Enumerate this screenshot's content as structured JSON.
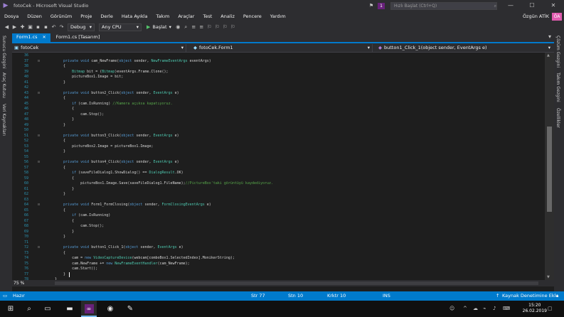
{
  "window": {
    "title": "fotoCek - Microsoft Visual Studio",
    "notifications_count": "1",
    "quick_launch_placeholder": "Hızlı Başlat (Ctrl+Q)",
    "minimize": "—",
    "maximize": "☐",
    "close": "✕"
  },
  "menu": {
    "items": [
      "Dosya",
      "Düzen",
      "Görünüm",
      "Proje",
      "Derle",
      "Hata Ayıkla",
      "Takım",
      "Araçlar",
      "Test",
      "Analiz",
      "Pencere",
      "Yardım"
    ],
    "user_name": "Özgün ATİK",
    "user_initials": "ÖA"
  },
  "toolbar": {
    "config": "Debug",
    "platform": "Any CPU",
    "run_label": "Başlat"
  },
  "left_dock": [
    "Sunucu Gezgini",
    "Araç Kutusu",
    "Veri Kaynakları"
  ],
  "right_dock": [
    "Çözüm Gezgini",
    "Takım Gezgini",
    "Özellikler"
  ],
  "tabs": [
    {
      "label": "Form1.cs",
      "close": "✕"
    },
    {
      "label": "Form1.cs [Tasarım]"
    }
  ],
  "navbar": {
    "project": "fotoCek",
    "class": "fotoCek.Form1",
    "member": "button1_Click_1(object sender, EventArgs e)"
  },
  "code_lines": [
    {
      "n": "36",
      "f": "",
      "t": [
        {
          "c": "",
          "s": ""
        }
      ]
    },
    {
      "n": "37",
      "f": "⊟",
      "t": [
        {
          "c": "kw",
          "s": "    private void "
        },
        {
          "c": "",
          "s": "cam_NewFrame("
        },
        {
          "c": "kw",
          "s": "object"
        },
        {
          "c": "",
          "s": " sender, "
        },
        {
          "c": "ty",
          "s": "NewFrameEventArgs"
        },
        {
          "c": "",
          "s": " eventArgs)"
        }
      ]
    },
    {
      "n": "38",
      "f": "",
      "t": [
        {
          "c": "",
          "s": "    {"
        }
      ]
    },
    {
      "n": "39",
      "f": "",
      "t": [
        {
          "c": "",
          "s": "        "
        },
        {
          "c": "ty",
          "s": "Bitmap"
        },
        {
          "c": "",
          "s": " bit = ("
        },
        {
          "c": "ty",
          "s": "Bitmap"
        },
        {
          "c": "",
          "s": ")eventArgs.Frame.Clone();"
        }
      ]
    },
    {
      "n": "40",
      "f": "",
      "t": [
        {
          "c": "",
          "s": "        pictureBox1.Image = bit;"
        }
      ]
    },
    {
      "n": "41",
      "f": "",
      "t": [
        {
          "c": "",
          "s": "    }"
        }
      ]
    },
    {
      "n": "42",
      "f": "",
      "t": [
        {
          "c": "",
          "s": ""
        }
      ]
    },
    {
      "n": "43",
      "f": "⊟",
      "t": [
        {
          "c": "kw",
          "s": "    private void "
        },
        {
          "c": "",
          "s": "button2_Click("
        },
        {
          "c": "kw",
          "s": "object"
        },
        {
          "c": "",
          "s": " sender, "
        },
        {
          "c": "ty",
          "s": "EventArgs"
        },
        {
          "c": "",
          "s": " e)"
        }
      ]
    },
    {
      "n": "44",
      "f": "",
      "t": [
        {
          "c": "",
          "s": "    {"
        }
      ]
    },
    {
      "n": "45",
      "f": "",
      "t": [
        {
          "c": "kw",
          "s": "        if"
        },
        {
          "c": "",
          "s": " (cam.IsRunning) "
        },
        {
          "c": "cm",
          "s": "//Kamera açıksa kapatıyoruz."
        }
      ]
    },
    {
      "n": "46",
      "f": "",
      "t": [
        {
          "c": "",
          "s": "        {"
        }
      ]
    },
    {
      "n": "47",
      "f": "",
      "t": [
        {
          "c": "",
          "s": "            cam.Stop();"
        }
      ]
    },
    {
      "n": "48",
      "f": "",
      "t": [
        {
          "c": "",
          "s": "        }"
        }
      ]
    },
    {
      "n": "49",
      "f": "",
      "t": [
        {
          "c": "",
          "s": "    }"
        }
      ]
    },
    {
      "n": "50",
      "f": "",
      "t": [
        {
          "c": "",
          "s": ""
        }
      ]
    },
    {
      "n": "51",
      "f": "⊟",
      "t": [
        {
          "c": "kw",
          "s": "    private void "
        },
        {
          "c": "",
          "s": "button3_Click("
        },
        {
          "c": "kw",
          "s": "object"
        },
        {
          "c": "",
          "s": " sender, "
        },
        {
          "c": "ty",
          "s": "EventArgs"
        },
        {
          "c": "",
          "s": " e)"
        }
      ]
    },
    {
      "n": "52",
      "f": "",
      "t": [
        {
          "c": "",
          "s": "    {"
        }
      ]
    },
    {
      "n": "53",
      "f": "",
      "t": [
        {
          "c": "",
          "s": "        pictureBox2.Image = pictureBox1.Image;"
        }
      ]
    },
    {
      "n": "54",
      "f": "",
      "t": [
        {
          "c": "",
          "s": "    }"
        }
      ]
    },
    {
      "n": "55",
      "f": "",
      "t": [
        {
          "c": "",
          "s": ""
        }
      ]
    },
    {
      "n": "56",
      "f": "⊟",
      "t": [
        {
          "c": "kw",
          "s": "    private void "
        },
        {
          "c": "",
          "s": "button4_Click("
        },
        {
          "c": "kw",
          "s": "object"
        },
        {
          "c": "",
          "s": " sender, "
        },
        {
          "c": "ty",
          "s": "EventArgs"
        },
        {
          "c": "",
          "s": " e)"
        }
      ]
    },
    {
      "n": "57",
      "f": "",
      "t": [
        {
          "c": "",
          "s": "    {"
        }
      ]
    },
    {
      "n": "58",
      "f": "",
      "t": [
        {
          "c": "kw",
          "s": "        if"
        },
        {
          "c": "",
          "s": " (saveFileDialog1.ShowDialog() == "
        },
        {
          "c": "ty",
          "s": "DialogResult"
        },
        {
          "c": "",
          "s": ".OK)"
        }
      ]
    },
    {
      "n": "59",
      "f": "",
      "t": [
        {
          "c": "",
          "s": "        {"
        }
      ]
    },
    {
      "n": "60",
      "f": "",
      "t": [
        {
          "c": "",
          "s": "            pictureBox1.Image.Save(saveFileDialog1.FileName);"
        },
        {
          "c": "cm",
          "s": "//PictureBox'taki görüntüyü kaydediyoruz."
        }
      ]
    },
    {
      "n": "61",
      "f": "",
      "t": [
        {
          "c": "",
          "s": "        }"
        }
      ]
    },
    {
      "n": "62",
      "f": "",
      "t": [
        {
          "c": "",
          "s": "    }"
        }
      ]
    },
    {
      "n": "63",
      "f": "",
      "t": [
        {
          "c": "",
          "s": ""
        }
      ]
    },
    {
      "n": "64",
      "f": "⊟",
      "t": [
        {
          "c": "kw",
          "s": "    private void "
        },
        {
          "c": "",
          "s": "Form1_FormClosing("
        },
        {
          "c": "kw",
          "s": "object"
        },
        {
          "c": "",
          "s": " sender, "
        },
        {
          "c": "ty",
          "s": "FormClosingEventArgs"
        },
        {
          "c": "",
          "s": " e)"
        }
      ]
    },
    {
      "n": "65",
      "f": "",
      "t": [
        {
          "c": "",
          "s": "    {"
        }
      ]
    },
    {
      "n": "66",
      "f": "",
      "t": [
        {
          "c": "kw",
          "s": "        if"
        },
        {
          "c": "",
          "s": " (cam.IsRunning)"
        }
      ]
    },
    {
      "n": "67",
      "f": "",
      "t": [
        {
          "c": "",
          "s": "        {"
        }
      ]
    },
    {
      "n": "68",
      "f": "",
      "t": [
        {
          "c": "",
          "s": "            cam.Stop();"
        }
      ]
    },
    {
      "n": "69",
      "f": "",
      "t": [
        {
          "c": "",
          "s": "        }"
        }
      ]
    },
    {
      "n": "70",
      "f": "",
      "t": [
        {
          "c": "",
          "s": "    }"
        }
      ]
    },
    {
      "n": "71",
      "f": "",
      "t": [
        {
          "c": "",
          "s": ""
        }
      ]
    },
    {
      "n": "72",
      "f": "⊟",
      "t": [
        {
          "c": "kw",
          "s": "    private void "
        },
        {
          "c": "",
          "s": "button1_Click_1("
        },
        {
          "c": "kw",
          "s": "object"
        },
        {
          "c": "",
          "s": " sender, "
        },
        {
          "c": "ty",
          "s": "EventArgs"
        },
        {
          "c": "",
          "s": " e)"
        }
      ]
    },
    {
      "n": "73",
      "f": "",
      "t": [
        {
          "c": "",
          "s": "    {"
        }
      ]
    },
    {
      "n": "74",
      "f": "",
      "t": [
        {
          "c": "",
          "s": "        cam = "
        },
        {
          "c": "kw",
          "s": "new "
        },
        {
          "c": "ty",
          "s": "VideoCaptureDevice"
        },
        {
          "c": "",
          "s": "(webcam[comboBox1.SelectedIndex].MonikerString);"
        }
      ]
    },
    {
      "n": "75",
      "f": "",
      "t": [
        {
          "c": "",
          "s": "        cam.NewFrame += "
        },
        {
          "c": "kw",
          "s": "new "
        },
        {
          "c": "ty",
          "s": "NewFrameEventHandler"
        },
        {
          "c": "",
          "s": "(cam_NewFrame);"
        }
      ]
    },
    {
      "n": "76",
      "f": "",
      "t": [
        {
          "c": "",
          "s": "        cam.Start();"
        }
      ]
    },
    {
      "n": "77",
      "f": "",
      "t": [
        {
          "c": "",
          "s": "    }"
        }
      ]
    },
    {
      "n": "78",
      "f": "",
      "t": [
        {
          "c": "",
          "s": "}"
        }
      ]
    },
    {
      "n": "79",
      "f": "",
      "t": [
        {
          "c": "",
          "s": ""
        }
      ]
    }
  ],
  "editor": {
    "zoom": "75 %"
  },
  "status": {
    "state": "Hazır",
    "line": "Str 77",
    "col": "Stn 10",
    "char": "Krktr 10",
    "mode": "INS",
    "source_control": "Kaynak Denetimine Ekle"
  },
  "taskbar": {
    "time": "15:20",
    "date": "26.02.2019"
  }
}
